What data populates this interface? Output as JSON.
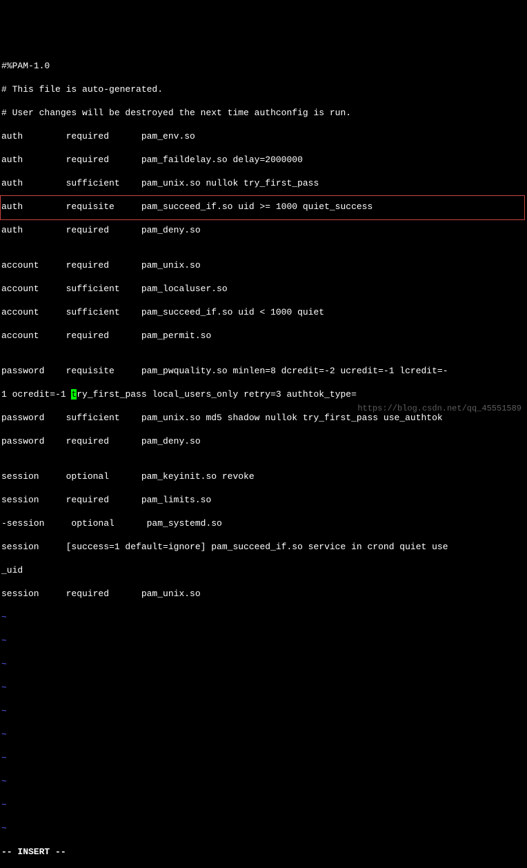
{
  "lines": {
    "l1": "#%PAM-1.0",
    "l2": "# This file is auto-generated.",
    "l3": "# User changes will be destroyed the next time authconfig is run.",
    "l4": "auth        required      pam_env.so",
    "l5": "auth        required      pam_faildelay.so delay=2000000",
    "l6": "auth        sufficient    pam_unix.so nullok try_first_pass",
    "l7": "auth        requisite     pam_succeed_if.so uid >= 1000 quiet_success",
    "l8": "auth        required      pam_deny.so",
    "l9": "",
    "l10": "account     required      pam_unix.so",
    "l11": "account     sufficient    pam_localuser.so",
    "l12": "account     sufficient    pam_succeed_if.so uid < 1000 quiet",
    "l13": "account     required      pam_permit.so",
    "l14": "",
    "hl1a": "password    requisite     pam_pwquality.so minlen=8 dcredit=-2 ucredit=-1 lcredit=-",
    "hl2a": "1 ocredit=-1 ",
    "hl2cursor": "t",
    "hl2b": "ry_first_pass local_users_only retry=3 authtok_type=",
    "l17": "password    sufficient    pam_unix.so md5 shadow nullok try_first_pass use_authtok",
    "l18": "password    required      pam_deny.so",
    "l19": "",
    "l20": "session     optional      pam_keyinit.so revoke",
    "l21": "session     required      pam_limits.so",
    "l22": "-session     optional      pam_systemd.so",
    "l23": "session     [success=1 default=ignore] pam_succeed_if.so service in crond quiet use",
    "l24": "_uid",
    "l25": "session     required      pam_unix.so",
    "t": "~"
  },
  "status": "-- INSERT --",
  "watermark": "https://blog.csdn.net/qq_45551589"
}
